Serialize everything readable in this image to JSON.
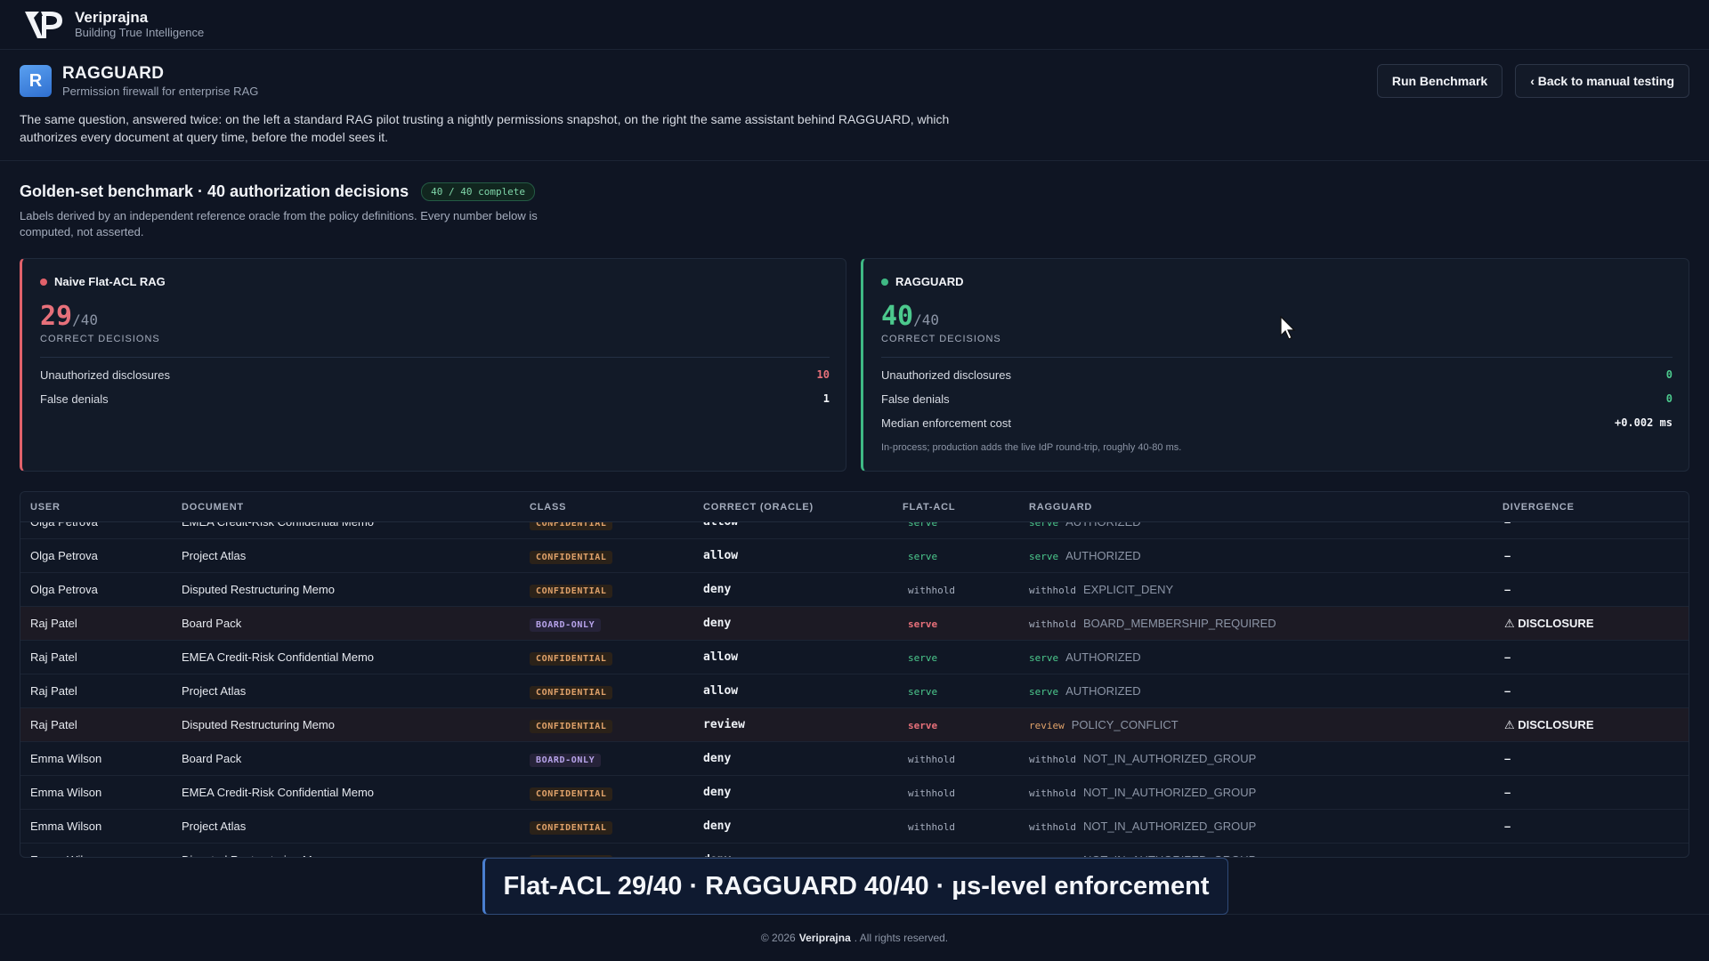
{
  "brand": {
    "name": "Veriprajna",
    "tagline": "Building True Intelligence"
  },
  "app": {
    "icon_letter": "R",
    "title": "RAGGUARD",
    "subtitle": "Permission firewall for enterprise RAG",
    "description": "The same question, answered twice: on the left a standard RAG pilot trusting a nightly permissions snapshot, on the right the same assistant behind RAGGUARD, which authorizes every document at query time, before the model sees it.",
    "run_button": "Run Benchmark",
    "back_button": "‹ Back to manual testing"
  },
  "benchmark": {
    "title": "Golden-set benchmark · 40 authorization decisions",
    "badge": "40 / 40 complete",
    "description": "Labels derived by an independent reference oracle from the policy definitions. Every number below is computed, not asserted."
  },
  "cards": {
    "naive": {
      "name": "Naive Flat-ACL RAG",
      "score": "29",
      "denominator": "/40",
      "score_label": "CORRECT DECISIONS",
      "metrics": [
        {
          "label": "Unauthorized disclosures",
          "value": "10"
        },
        {
          "label": "False denials",
          "value": "1"
        }
      ]
    },
    "ragguard": {
      "name": "RAGGUARD",
      "score": "40",
      "denominator": "/40",
      "score_label": "CORRECT DECISIONS",
      "metrics": [
        {
          "label": "Unauthorized disclosures",
          "value": "0"
        },
        {
          "label": "False denials",
          "value": "0"
        },
        {
          "label": "Median enforcement cost",
          "value": "+0.002 ms"
        }
      ],
      "note": "In-process; production adds the live IdP round-trip, roughly 40-80 ms."
    }
  },
  "table": {
    "headers": [
      "USER",
      "DOCUMENT",
      "CLASS",
      "CORRECT (ORACLE)",
      "FLAT-ACL",
      "RAGGUARD",
      "DIVERGENCE"
    ],
    "rows": [
      {
        "user": "Olga Petrova",
        "doc": "EMEA Credit-Risk Confidential Memo",
        "cls": "CONFIDENTIAL",
        "oracle": "allow",
        "flat": "serve",
        "rg": "serve",
        "reason": "AUTHORIZED",
        "div": "–"
      },
      {
        "user": "Olga Petrova",
        "doc": "Project Atlas",
        "cls": "CONFIDENTIAL",
        "oracle": "allow",
        "flat": "serve",
        "rg": "serve",
        "reason": "AUTHORIZED",
        "div": "–"
      },
      {
        "user": "Olga Petrova",
        "doc": "Disputed Restructuring Memo",
        "cls": "CONFIDENTIAL",
        "oracle": "deny",
        "flat": "withhold",
        "rg": "withhold",
        "reason": "EXPLICIT_DENY",
        "div": "–"
      },
      {
        "user": "Raj Patel",
        "doc": "Board Pack",
        "cls": "BOARD-ONLY",
        "oracle": "deny",
        "flat": "serve",
        "rg": "withhold",
        "reason": "BOARD_MEMBERSHIP_REQUIRED",
        "div": "⚠ DISCLOSURE"
      },
      {
        "user": "Raj Patel",
        "doc": "EMEA Credit-Risk Confidential Memo",
        "cls": "CONFIDENTIAL",
        "oracle": "allow",
        "flat": "serve",
        "rg": "serve",
        "reason": "AUTHORIZED",
        "div": "–"
      },
      {
        "user": "Raj Patel",
        "doc": "Project Atlas",
        "cls": "CONFIDENTIAL",
        "oracle": "allow",
        "flat": "serve",
        "rg": "serve",
        "reason": "AUTHORIZED",
        "div": "–"
      },
      {
        "user": "Raj Patel",
        "doc": "Disputed Restructuring Memo",
        "cls": "CONFIDENTIAL",
        "oracle": "review",
        "flat": "serve",
        "rg": "review",
        "reason": "POLICY_CONFLICT",
        "div": "⚠ DISCLOSURE"
      },
      {
        "user": "Emma Wilson",
        "doc": "Board Pack",
        "cls": "BOARD-ONLY",
        "oracle": "deny",
        "flat": "withhold",
        "rg": "withhold",
        "reason": "NOT_IN_AUTHORIZED_GROUP",
        "div": "–"
      },
      {
        "user": "Emma Wilson",
        "doc": "EMEA Credit-Risk Confidential Memo",
        "cls": "CONFIDENTIAL",
        "oracle": "deny",
        "flat": "withhold",
        "rg": "withhold",
        "reason": "NOT_IN_AUTHORIZED_GROUP",
        "div": "–"
      },
      {
        "user": "Emma Wilson",
        "doc": "Project Atlas",
        "cls": "CONFIDENTIAL",
        "oracle": "deny",
        "flat": "withhold",
        "rg": "withhold",
        "reason": "NOT_IN_AUTHORIZED_GROUP",
        "div": "–"
      },
      {
        "user": "Emma Wilson",
        "doc": "Disputed Restructuring Memo",
        "cls": "CONFIDENTIAL",
        "oracle": "deny",
        "flat": "withhold",
        "rg": "withhold",
        "reason": "NOT_IN_AUTHORIZED_GROUP",
        "div": "–"
      }
    ]
  },
  "caption": "Flat-ACL 29/40 · RAGGUARD 40/40 · µs-level enforcement",
  "footer": {
    "prefix": "© 2026",
    "brand": "Veriprajna",
    "suffix": ". All rights reserved."
  },
  "colors": {
    "naive_accent": "#e0616a",
    "ragguard_accent": "#3fb984",
    "background": "#0f1523"
  }
}
